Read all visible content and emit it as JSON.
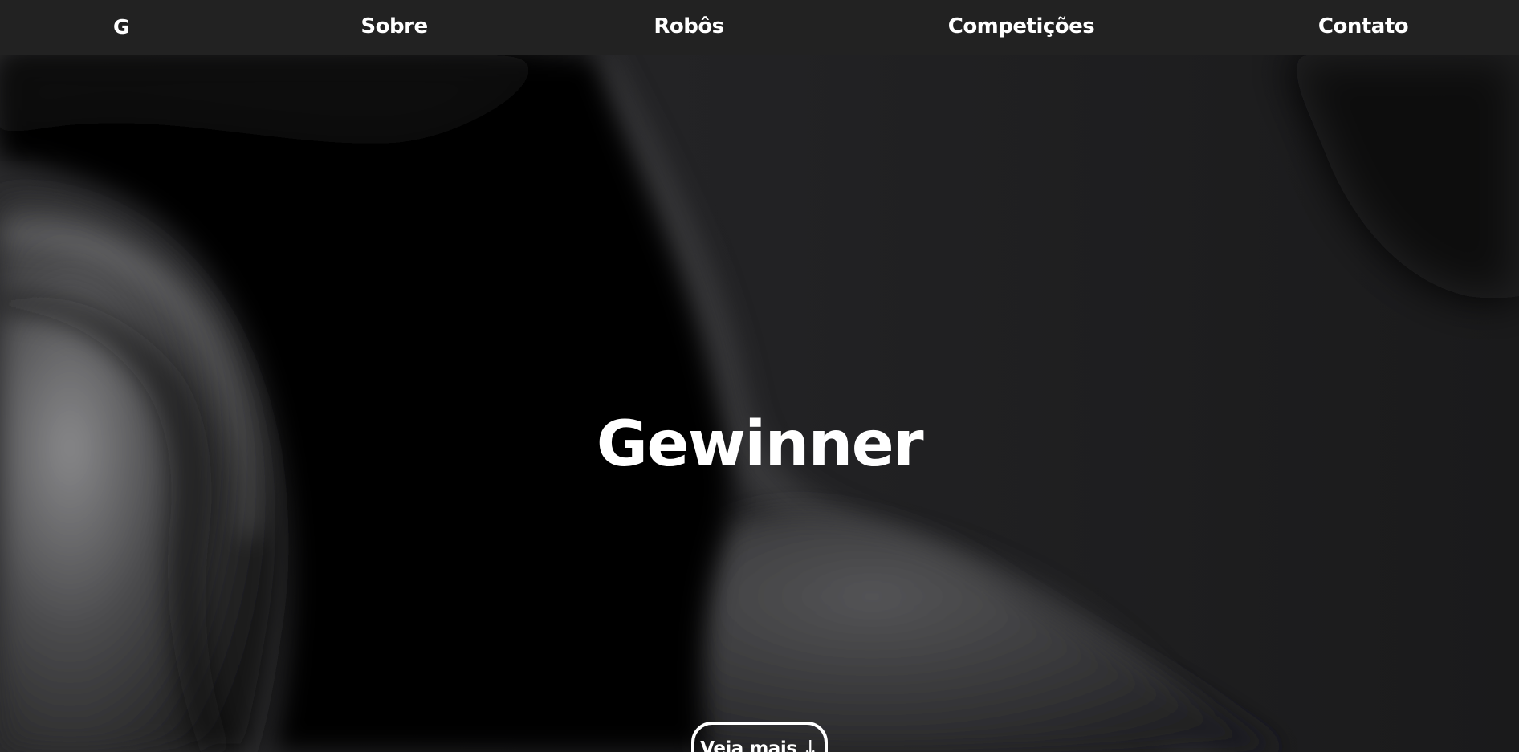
{
  "nav": {
    "logo": "G",
    "items": [
      {
        "label": "Sobre"
      },
      {
        "label": "Robôs"
      },
      {
        "label": "Competições"
      },
      {
        "label": "Contato"
      }
    ]
  },
  "hero": {
    "title": "Gewinner",
    "cta_label": "Veja mais",
    "cta_icon": "↓"
  },
  "colors": {
    "navbar_bg": "#222222",
    "text": "#ffffff",
    "hero_bg": "#1e1e20"
  }
}
